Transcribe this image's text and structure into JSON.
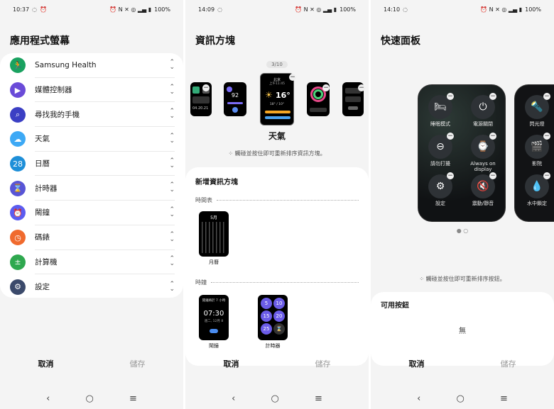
{
  "panel1": {
    "status": {
      "time": "10:37",
      "battery": "100%"
    },
    "title": "應用程式螢幕",
    "items": [
      {
        "label": "Samsung Health",
        "icon": "health-icon",
        "color": "#1aa260"
      },
      {
        "label": "媒體控制器",
        "icon": "play-icon",
        "color": "#6a4bd8"
      },
      {
        "label": "尋找我的手機",
        "icon": "find-phone-icon",
        "color": "#3b3fc4"
      },
      {
        "label": "天氣",
        "icon": "weather-icon",
        "color": "#3da9f5"
      },
      {
        "label": "日曆",
        "icon": "calendar-icon",
        "color": "#1e8fd8",
        "glyph": "28"
      },
      {
        "label": "計時器",
        "icon": "hourglass-icon",
        "color": "#5855d6"
      },
      {
        "label": "鬧鐘",
        "icon": "alarm-icon",
        "color": "#5c5cf0"
      },
      {
        "label": "碼錶",
        "icon": "stopwatch-icon",
        "color": "#f06a2e"
      },
      {
        "label": "計算機",
        "icon": "calculator-icon",
        "color": "#2fa84f"
      },
      {
        "label": "設定",
        "icon": "gear-icon",
        "color": "#3b4a6b"
      }
    ],
    "cancel": "取消",
    "save": "儲存"
  },
  "panel2": {
    "status": {
      "time": "14:09",
      "battery": "100%"
    },
    "title": "資訊方塊",
    "page_indicator": "3/10",
    "center_tile": {
      "city": "北京",
      "time_label": "上午11:45",
      "temp": "16°",
      "range": "18° / 10°",
      "tile_name": "天氣"
    },
    "tiles": {
      "left_small_value": "92",
      "right_small_date": "04.20.21"
    },
    "hint": "觸碰並按住即可重新排序資訊方塊。",
    "add_title": "新增資訊方塊",
    "section_calendar": "時間表",
    "calendar_month": "5月",
    "calendar_label": "月曆",
    "section_alarm": "時鐘",
    "alarm_preview": {
      "header": "開鐘將於 7 小時",
      "time": "07:30",
      "date": "週二, 12月 8"
    },
    "alarm_label": "鬧鐘",
    "timer_values": [
      "5",
      "10",
      "15",
      "20",
      "25"
    ],
    "timer_label": "計時器",
    "cancel": "取消",
    "save": "儲存"
  },
  "panel3": {
    "status": {
      "time": "14:10",
      "battery": "100%"
    },
    "title": "快速面板",
    "buttons": [
      {
        "label": "睡眠模式",
        "icon": "bed-icon"
      },
      {
        "label": "電源關閉",
        "icon": "power-icon"
      },
      {
        "label": "請勿打擾",
        "icon": "do-not-disturb-icon"
      },
      {
        "label": "Always on display",
        "icon": "watch-icon"
      },
      {
        "label": "設定",
        "icon": "gear-icon"
      },
      {
        "label": "震動/靜音",
        "icon": "vibrate-mute-icon"
      }
    ],
    "side_buttons": [
      {
        "label": "閃光燈",
        "icon": "flashlight-icon"
      },
      {
        "label": "影院",
        "icon": "theater-icon"
      },
      {
        "label": "水中鎖定",
        "icon": "water-lock-icon"
      }
    ],
    "hint": "觸碰並按住即可重新排序按鈕。",
    "available_title": "可用按鈕",
    "empty_text": "無",
    "cancel": "取消",
    "save": "儲存"
  }
}
